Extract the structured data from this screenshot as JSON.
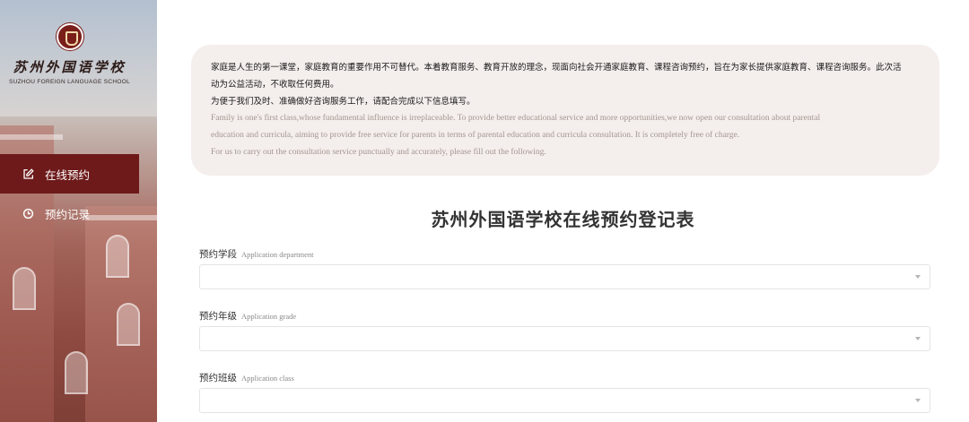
{
  "sidebar": {
    "logo": {
      "name_cn": "苏州外国语学校",
      "name_en": "SUZHOU FOREIGN LANGUAGE SCHOOL"
    },
    "items": [
      {
        "label": "在线预约",
        "icon": "edit-icon",
        "active": true
      },
      {
        "label": "预约记录",
        "icon": "clock-icon",
        "active": false
      }
    ],
    "colors": {
      "active_bg": "#6e1a1a"
    }
  },
  "notice": {
    "cn_line1": "家庭是人生的第一课堂，家庭教育的重要作用不可替代。本着教育服务、教育开放的理念，现面向社会开通家庭教育、课程咨询预约，旨在为家长提供家庭教育、课程咨询服务。此次活",
    "cn_line2": "动为公益活动，不收取任何费用。",
    "cn_line3": "为便于我们及时、准确做好咨询服务工作，请配合完成以下信息填写。",
    "en_line1": "Family is one's first class,whose fundamental influence is irreplaceable. To provide better educational service and more opportunities,we now open our consultation about parental",
    "en_line2": "education and curricula, aiming to provide free service for parents in terms of parental education and curricula consultation. It is completely free of charge.",
    "en_line3": "For us to carry out the consultation service punctually and accurately, please fill out the following."
  },
  "form": {
    "title": "苏州外国语学校在线预约登记表",
    "fields": [
      {
        "label_cn": "预约学段",
        "label_en": "Application department",
        "value": ""
      },
      {
        "label_cn": "预约年级",
        "label_en": "Application grade",
        "value": ""
      },
      {
        "label_cn": "预约班级",
        "label_en": "Application class",
        "value": ""
      }
    ]
  }
}
